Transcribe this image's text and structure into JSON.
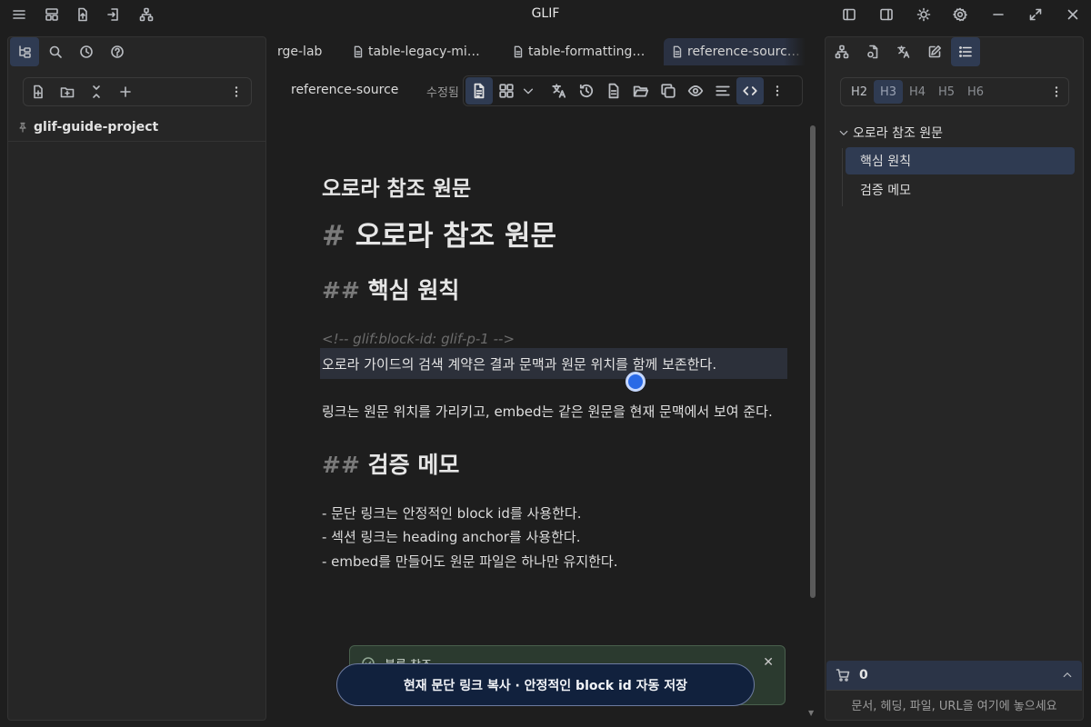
{
  "app": {
    "title": "GLIF"
  },
  "tabs": [
    {
      "label": "rge-lab",
      "active": false
    },
    {
      "label": "table-legacy-mi…",
      "active": false
    },
    {
      "label": "table-formatting…",
      "active": false
    },
    {
      "label": "reference-sourc…",
      "active": true
    }
  ],
  "left_panel": {
    "vault_name": "glif-guide-project"
  },
  "view_header": {
    "title": "reference-source",
    "status": "수정됨"
  },
  "editor": {
    "inline_title": "오로라 참조 원문",
    "h1_marker": "#",
    "h1_text": "오로라 참조 원문",
    "h2_marker": "##",
    "h2_core": "핵심 원칙",
    "block_comment": "<!-- glif:block-id: glif-p-1 -->",
    "para1": "오로라 가이드의 검색 계약은 결과 문맥과 원문 위치를 함께 보존한다.",
    "para2": "링크는 원문 위치를 가리키고, embed는 같은 원문을 현재 문맥에서 보여 준다.",
    "h2_verify": "검증 메모",
    "list": [
      "- 문단 링크는 안정적인 block id를 사용한다.",
      "- 섹션 링크는 heading anchor를 사용한다.",
      "- embed를 만들어도 원문 파일은 하나만 유지한다."
    ]
  },
  "notice": {
    "title": "블록 참조",
    "close": "✕"
  },
  "toast": {
    "text": "현재 문단 링크 복사 · 안정적인 block id 자동 저장"
  },
  "right_panel": {
    "heading_levels": [
      "H2",
      "H3",
      "H4",
      "H5",
      "H6"
    ],
    "outline_root": "오로라 참조 원문",
    "outline_items": [
      "핵심 원칙",
      "검증 메모"
    ],
    "bucket_count": "0",
    "dropzone_text": "문서, 헤딩, 파일, URL을 여기에 놓으세요"
  },
  "colors": {
    "accent": "#2f3b52",
    "toast_bg": "#11213d",
    "cursor": "#2a6ae6",
    "notice_bg": "#2b3a2f"
  },
  "icons": {
    "titlebar_left": [
      "menu-icon",
      "layout-icon",
      "file-export-icon",
      "file-import-icon",
      "graph-icon"
    ],
    "titlebar_right": [
      "left-sidebar-icon",
      "right-sidebar-icon",
      "sun-icon",
      "gear-icon",
      "minimize-icon",
      "maximize-icon",
      "close-icon"
    ],
    "left_tabs": [
      "file-tree-icon",
      "search-icon",
      "history-icon",
      "help-icon"
    ],
    "left_toolbar": [
      "new-note-icon",
      "new-folder-icon",
      "collapse-all-icon",
      "add-icon",
      "more-icon"
    ],
    "view_toolbar": [
      "document-icon",
      "grid-icon",
      "chevron-down-icon",
      "translate-icon",
      "history-icon",
      "file-icon",
      "folder-open-icon",
      "copy-icon",
      "eye-icon",
      "align-icon",
      "code-icon",
      "more-icon"
    ],
    "right_tabs": [
      "graph-icon",
      "file-link-icon",
      "translate-icon",
      "edit-icon",
      "outline-icon"
    ]
  }
}
